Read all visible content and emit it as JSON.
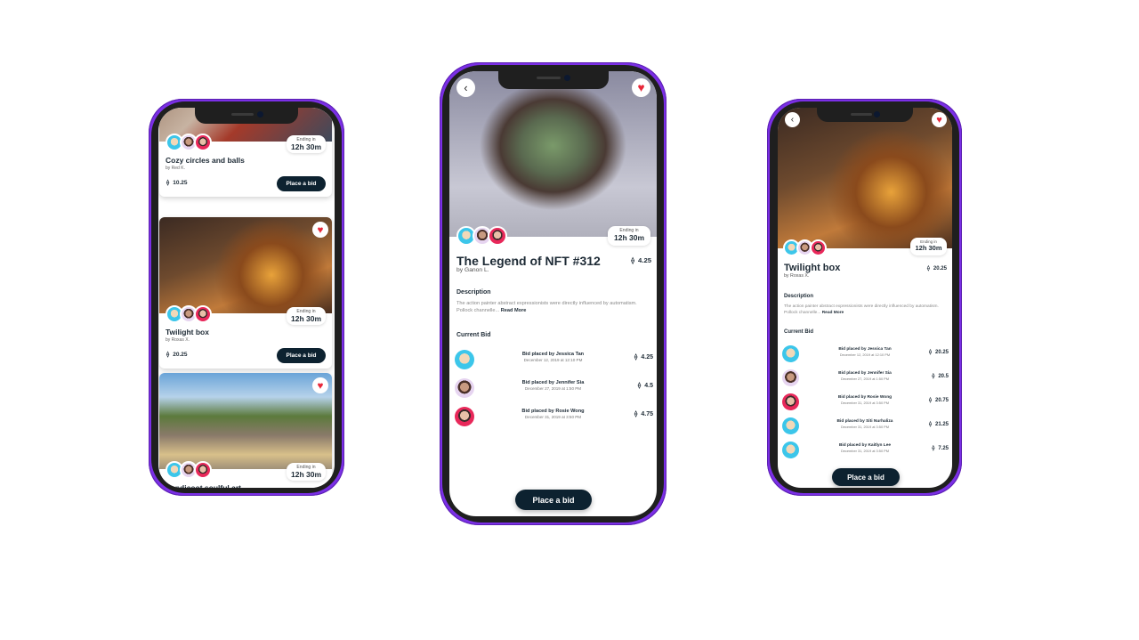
{
  "accent": "#7b2fe6",
  "button_color": "#0d2230",
  "heart_color": "#e8283a",
  "icons": {
    "back": "chevron-left-icon",
    "favorite": "heart-icon",
    "currency": "ethereum-icon"
  },
  "list_screen": {
    "cards": [
      {
        "title": "Cozy circles and balls",
        "author": "by Red K.",
        "price": "10.25",
        "ending_label": "Ending in",
        "ending_value": "12h 30m",
        "button": "Place a bid",
        "favorited": false
      },
      {
        "title": "Twilight box",
        "author": "by Roxas X.",
        "price": "20.25",
        "ending_label": "Ending in",
        "ending_value": "12h 30m",
        "button": "Place a bid",
        "favorited": true
      },
      {
        "title": "Bandicoot soulful art",
        "ending_label": "Ending in",
        "ending_value": "12h 30m",
        "favorited": true
      }
    ]
  },
  "detail_1": {
    "title": "The Legend of NFT #312",
    "author": "by Ganon L.",
    "price": "4.25",
    "ending_label": "Ending in",
    "ending_value": "12h 30m",
    "description_heading": "Description",
    "description": "The action painter abstract expressionists were directly influenced by automatism. Pollock channelle...",
    "read_more": "Read More",
    "bids_heading": "Current Bid",
    "button": "Place a bid",
    "bids": [
      {
        "who": "Bid placed by Jessica Tan",
        "when": "December 12, 2019 at 12:10 PM",
        "amount": "4.25"
      },
      {
        "who": "Bid placed by Jennifer Sia",
        "when": "December 27, 2019 at 1:50 PM",
        "amount": "4.5"
      },
      {
        "who": "Bid placed by Rosie Wong",
        "when": "December 31, 2019 at 3:50 PM",
        "amount": "4.75"
      }
    ]
  },
  "detail_2": {
    "title": "Twilight box",
    "author": "by Roxas X.",
    "price": "20.25",
    "ending_label": "Ending in",
    "ending_value": "12h 30m",
    "description_heading": "Description",
    "description": "The action painter abstract expressionists were directly influenced by automatism. Pollock channelle...",
    "read_more": "Read More",
    "bids_heading": "Current Bid",
    "button": "Place a bid",
    "bids": [
      {
        "who": "Bid placed by Jessica Tan",
        "when": "December 12, 2019 at 12:10 PM",
        "amount": "20.25"
      },
      {
        "who": "Bid placed by Jennifer Sia",
        "when": "December 27, 2019 at 1:50 PM",
        "amount": "20.5"
      },
      {
        "who": "Bid placed by Rosie Wong",
        "when": "December 31, 2019 at 3:50 PM",
        "amount": "20.75"
      },
      {
        "who": "Bid placed by Siti Nurhaliza",
        "when": "December 31, 2019 at 3:50 PM",
        "amount": "21.25"
      },
      {
        "who": "Bid placed by Kaitlyn Lee",
        "when": "December 31, 2019 at 3:50 PM",
        "amount": "7.25"
      }
    ]
  }
}
